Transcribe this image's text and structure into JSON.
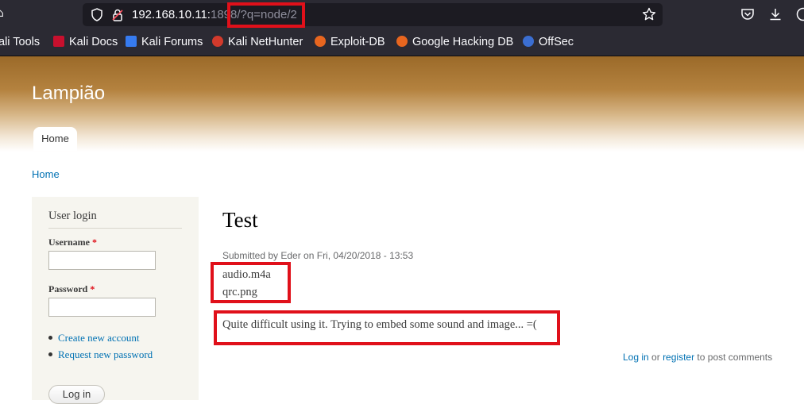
{
  "browser": {
    "url_host": "192.168.10.11:",
    "url_port_dim": "1898",
    "url_path": "/?q=node/2",
    "bookmarks": [
      {
        "label": "ali Tools",
        "icon": "kali-tools-icon"
      },
      {
        "label": "Kali Docs",
        "icon": "kali-docs-icon"
      },
      {
        "label": "Kali Forums",
        "icon": "kali-forums-icon"
      },
      {
        "label": "Kali NetHunter",
        "icon": "kali-nethunter-icon"
      },
      {
        "label": "Exploit-DB",
        "icon": "exploit-db-icon"
      },
      {
        "label": "Google Hacking DB",
        "icon": "google-hacking-db-icon"
      },
      {
        "label": "OffSec",
        "icon": "offsec-icon"
      }
    ],
    "annotation_color": "#e0101a"
  },
  "site": {
    "name": "Lampião",
    "tabs": [
      {
        "label": "Home"
      }
    ],
    "breadcrumb": "Home"
  },
  "sidebar": {
    "title": "User login",
    "username_label": "Username",
    "password_label": "Password",
    "required_mark": "*",
    "links": [
      "Create new account",
      "Request new password"
    ],
    "login_button": "Log in"
  },
  "node": {
    "title": "Test",
    "submitted": "Submitted by Eder on Fri, 04/20/2018 - 13:53",
    "attachments": [
      "audio.m4a",
      "qrc.png"
    ],
    "body": "Quite difficult using it. Trying to embed some sound and image... =(",
    "comment_login": "Log in",
    "comment_or": "or",
    "comment_register": "register",
    "comment_suffix": "to post comments"
  }
}
